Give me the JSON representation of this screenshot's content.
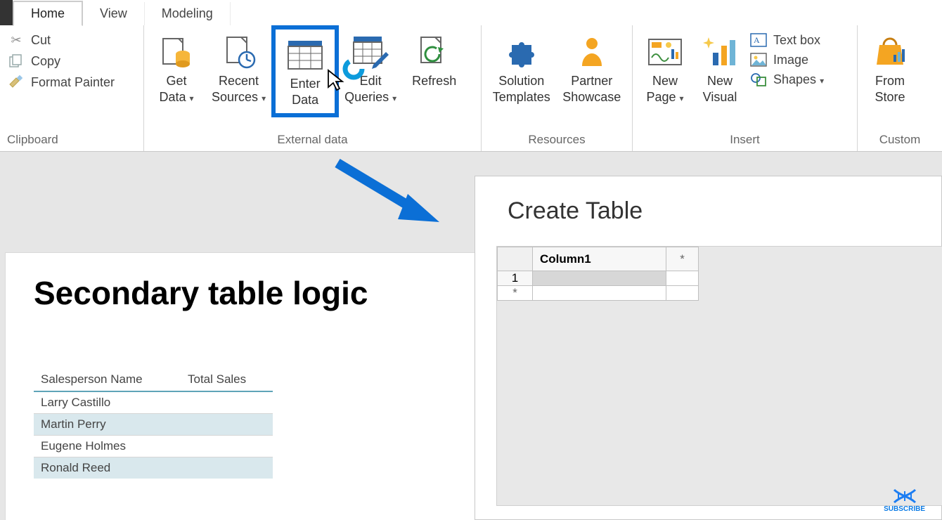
{
  "tabs": {
    "home": "Home",
    "view": "View",
    "modeling": "Modeling"
  },
  "clipboard": {
    "cut": "Cut",
    "copy": "Copy",
    "formatPainter": "Format Painter",
    "label": "Clipboard"
  },
  "externalData": {
    "getData": "Get\nData",
    "recentSources": "Recent\nSources",
    "enterData": "Enter\nData",
    "editQueries": "Edit\nQueries",
    "refresh": "Refresh",
    "label": "External data"
  },
  "resources": {
    "solutionTemplates": "Solution\nTemplates",
    "partnerShowcase": "Partner\nShowcase",
    "label": "Resources"
  },
  "insert": {
    "newPage": "New\nPage",
    "newVisual": "New\nVisual",
    "textBox": "Text box",
    "image": "Image",
    "shapes": "Shapes",
    "label": "Insert"
  },
  "custom": {
    "fromStore": "From\nStore",
    "label": "Custom"
  },
  "canvas": {
    "title": "Secondary table logic",
    "table": {
      "columns": [
        "Salesperson Name",
        "Total Sales"
      ],
      "rows": [
        {
          "name": "Larry Castillo",
          "total": ""
        },
        {
          "name": "Martin Perry",
          "total": ""
        },
        {
          "name": "Eugene Holmes",
          "total": ""
        },
        {
          "name": "Ronald Reed",
          "total": ""
        }
      ]
    }
  },
  "dialog": {
    "title": "Create Table",
    "column1": "Column1",
    "row1": "1",
    "star": "*"
  },
  "subscribe": "SUBSCRIBE",
  "caret": "▾"
}
